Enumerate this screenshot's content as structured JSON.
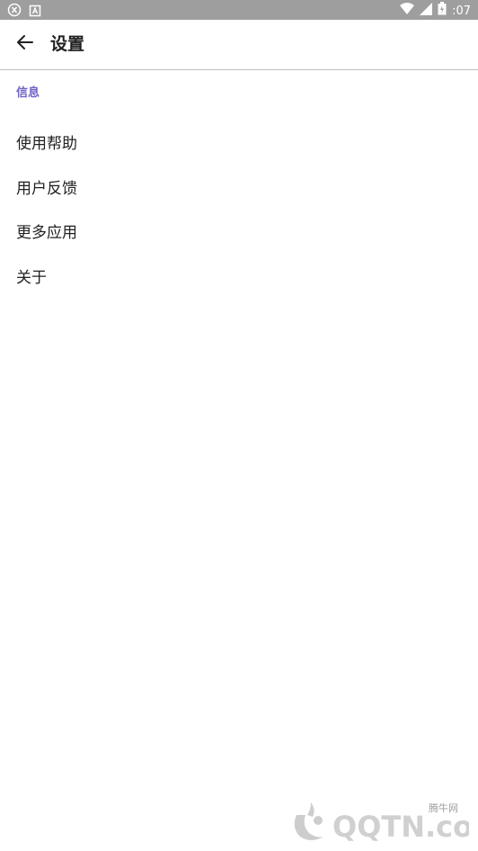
{
  "status_bar": {
    "time": ":07",
    "icons": [
      "x-circle-icon",
      "a-box-icon",
      "wifi-icon",
      "signal-icon",
      "battery-icon"
    ]
  },
  "toolbar": {
    "title": "设置",
    "back_icon": "arrow-left-icon"
  },
  "section": {
    "header": "信息",
    "items": [
      {
        "label": "使用帮助"
      },
      {
        "label": "用户反馈"
      },
      {
        "label": "更多应用"
      },
      {
        "label": "关于"
      }
    ]
  },
  "watermark": {
    "site_cn": "腾牛网",
    "site_en": "QQTN.com"
  },
  "colors": {
    "status_bar": "#9e9e9e",
    "accent": "#6f63c5",
    "text": "#212121",
    "divider": "#bdbdbd"
  }
}
